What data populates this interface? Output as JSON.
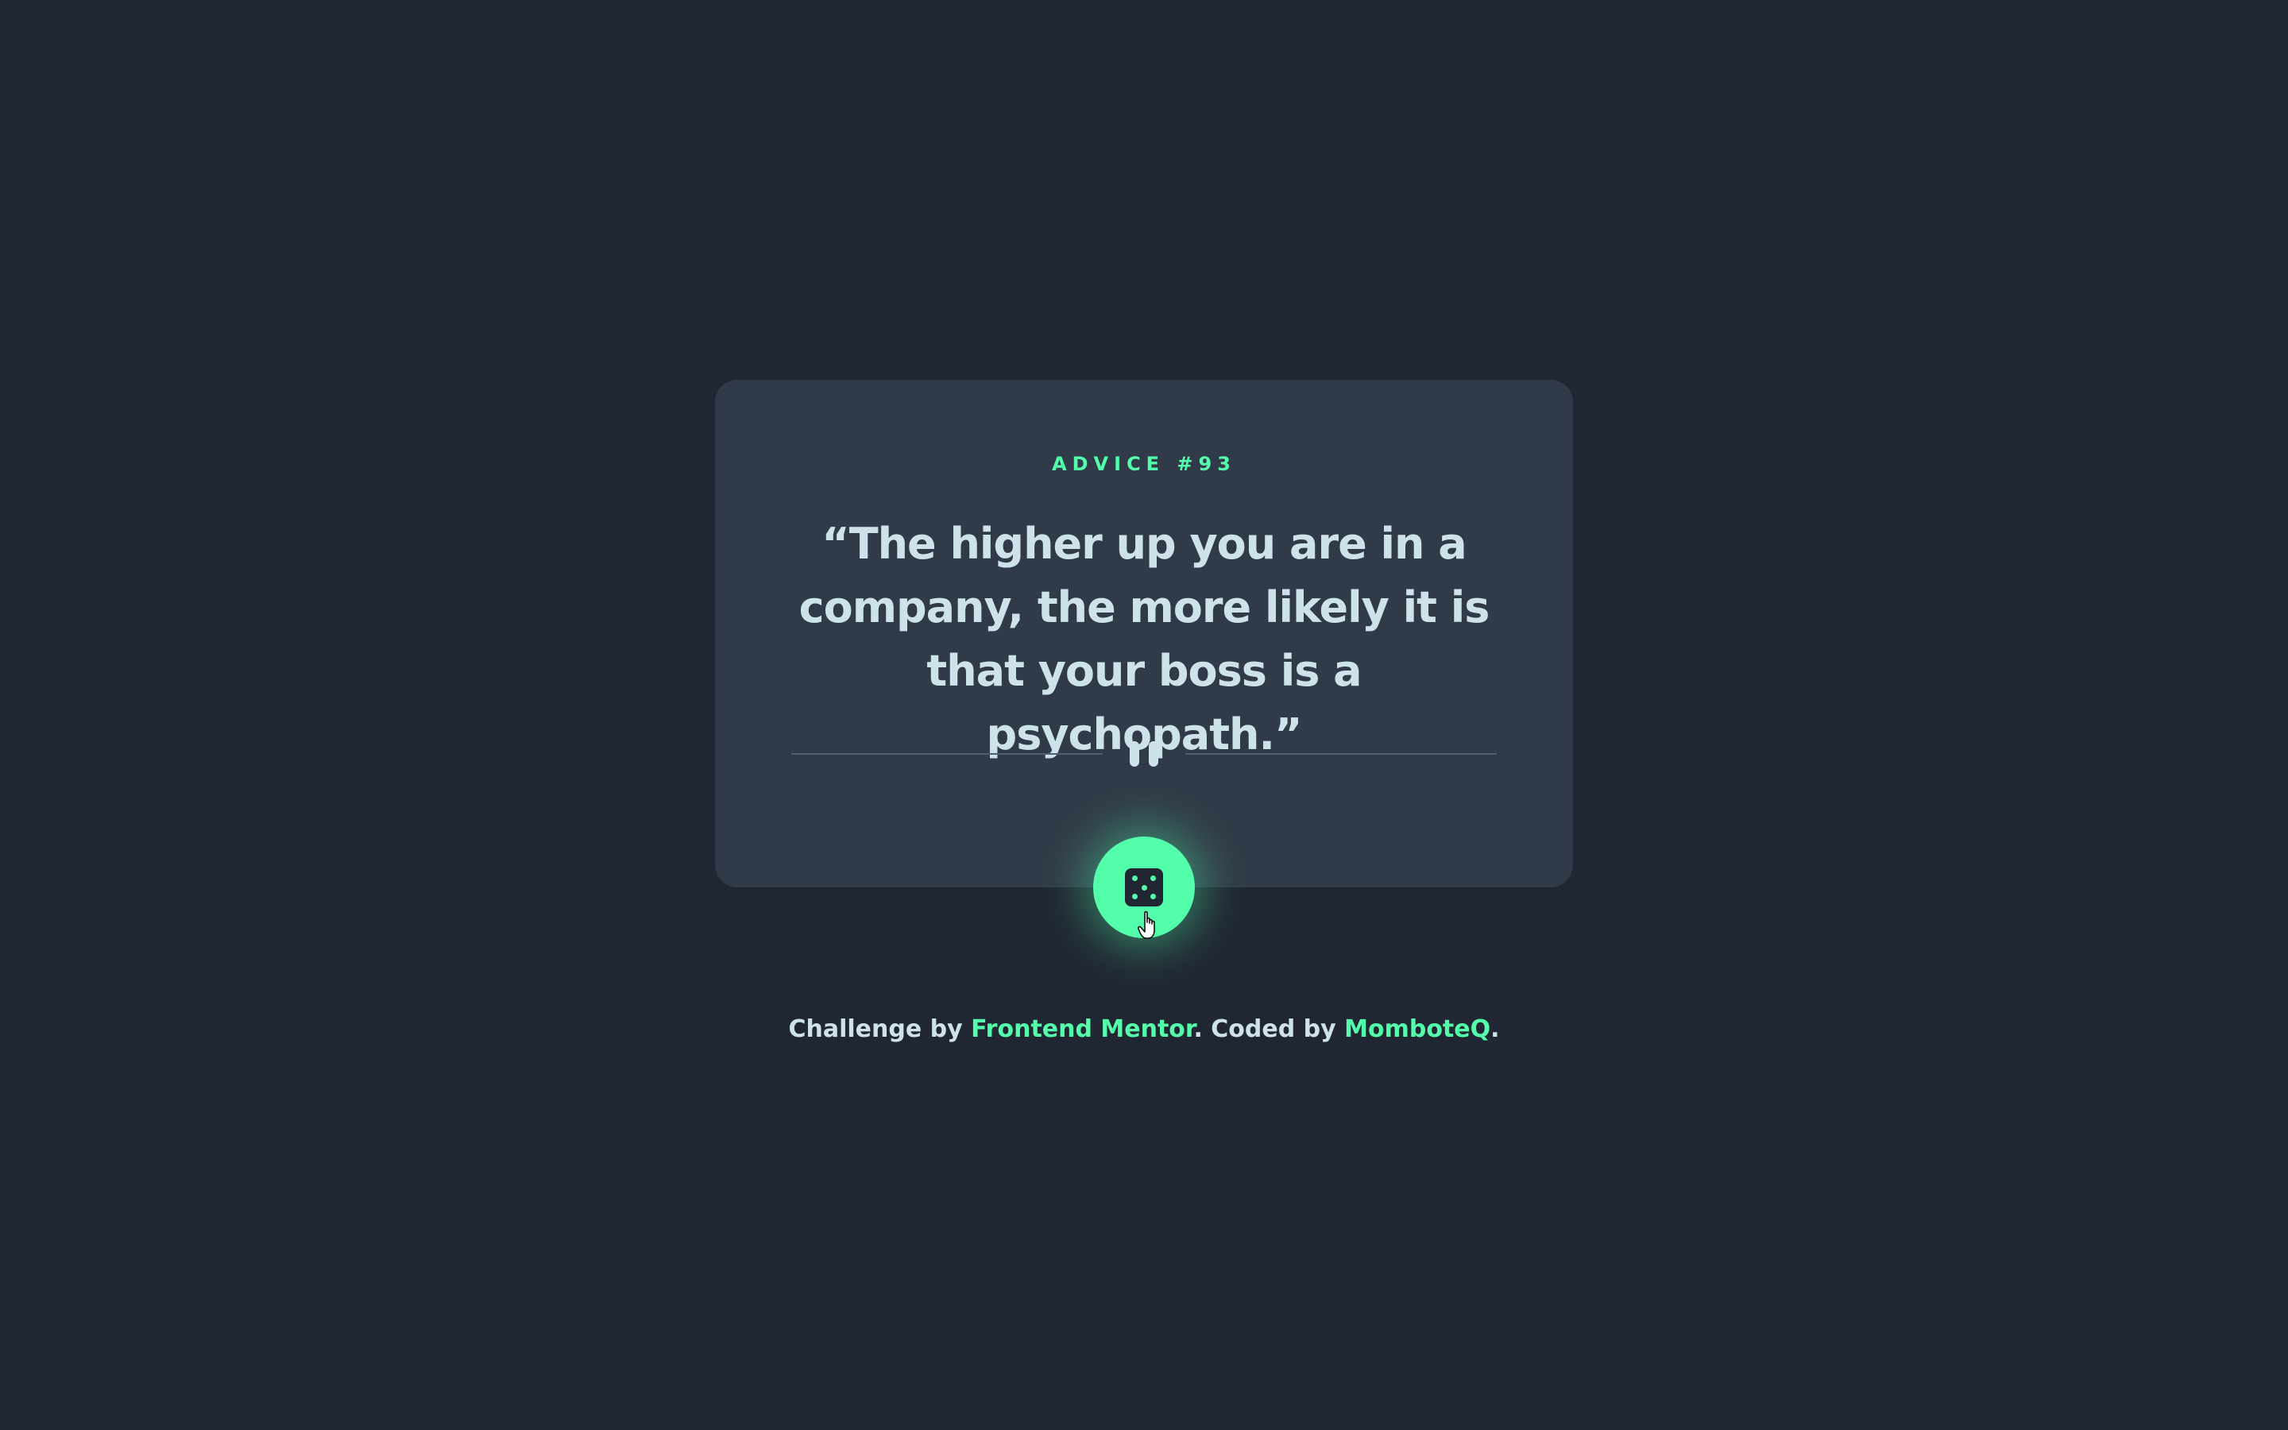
{
  "card": {
    "advice_label": "ADVICE #93",
    "quote": "“The higher up you are in a company, the more likely it is that your boss is a psychopath.”"
  },
  "divider": {
    "icon": "pause-icon"
  },
  "dice_button": {
    "icon": "dice-icon"
  },
  "footer": {
    "prefix": "Challenge by ",
    "link1_text": "Frontend Mentor",
    "middle": ". Coded by ",
    "link2_text": "MomboteQ",
    "suffix": "."
  },
  "colors": {
    "background": "#202632",
    "card": "#313a48",
    "accent": "#53ffaa",
    "text": "#cee3e9",
    "divider": "#4f5d74"
  }
}
